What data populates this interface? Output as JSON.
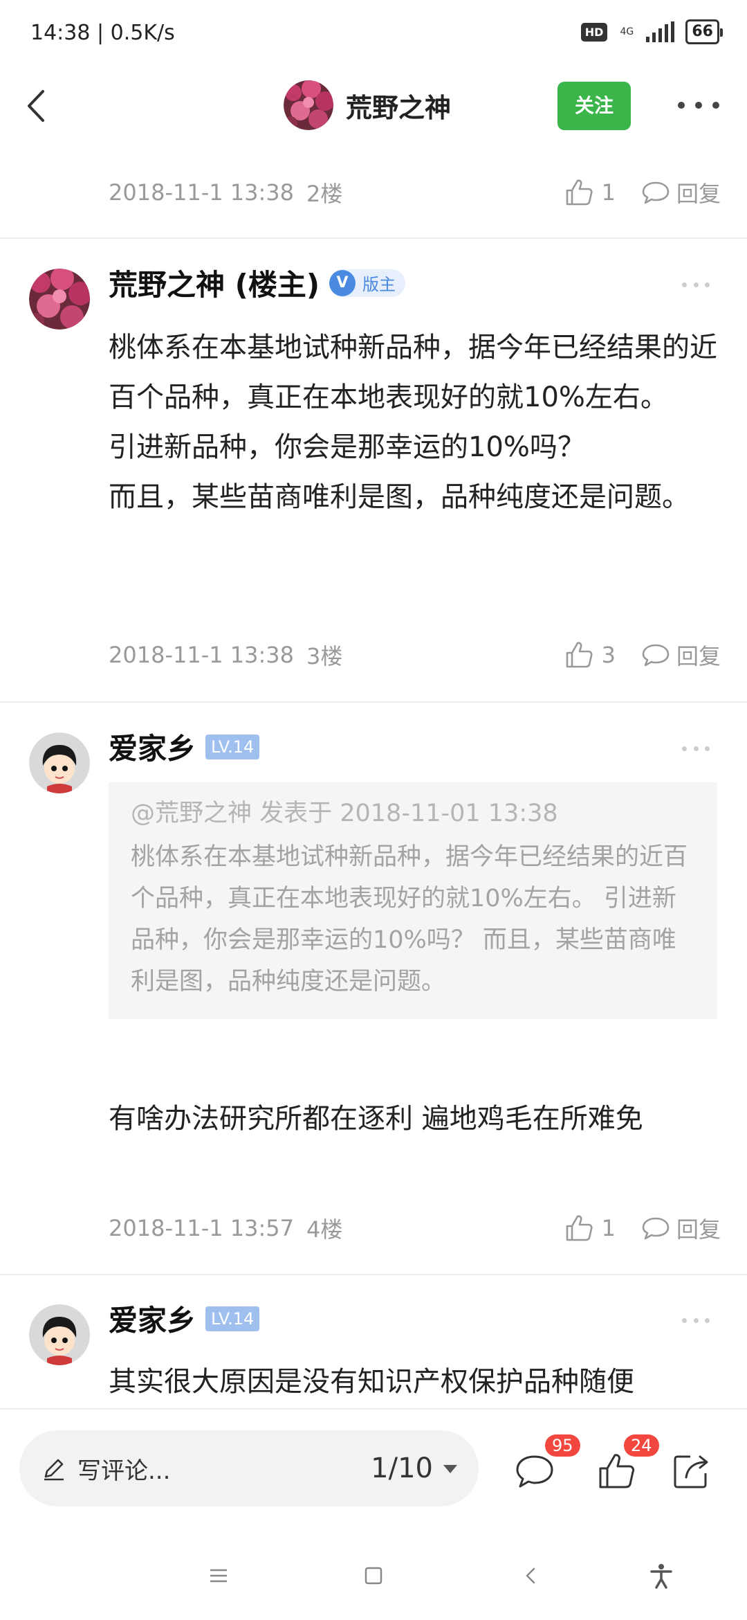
{
  "status_bar": {
    "time_speed": "14:38 | 0.5K/s",
    "hd": "HD",
    "network": "4G",
    "battery": "66"
  },
  "header": {
    "title": "荒野之神",
    "follow_label": "关注",
    "back_icon": "chevron-left-icon",
    "more_icon": "more-dots-icon"
  },
  "posts": [
    {
      "date": "2018-11-1 13:38",
      "floor": "2楼",
      "likes": "1",
      "reply_label": "回复"
    },
    {
      "author": "荒野之神 (楼主)",
      "badge_v": "V",
      "badge_role": "版主",
      "body_lines": [
        "桃体系在本基地试种新品种，据今年已经结果的近百个品种，真正在本地表现好的就10%左右。",
        "引进新品种，你会是那幸运的10%吗？",
        "而且，某些苗商唯利是图，品种纯度还是问题。"
      ],
      "date": "2018-11-1 13:38",
      "floor": "3楼",
      "likes": "3",
      "reply_label": "回复"
    },
    {
      "author": "爱家乡",
      "level": "LV.14",
      "quote_head": "@荒野之神 发表于 2018-11-01 13:38",
      "quote_text": "桃体系在本基地试种新品种，据今年已经结果的近百个品种，真正在本地表现好的就10%左右。 引进新品种，你会是那幸运的10%吗？ 而且，某些苗商唯利是图，品种纯度还是问题。",
      "body": "有啥办法研究所都在逐利 遍地鸡毛在所难免",
      "date": "2018-11-1 13:57",
      "floor": "4楼",
      "likes": "1",
      "reply_label": "回复"
    },
    {
      "author": "爱家乡",
      "level": "LV.14",
      "body": "其实很大原因是没有知识产权保护品种随便"
    }
  ],
  "bottom_bar": {
    "comment_placeholder": "写评论...",
    "page": "1/10",
    "comment_count": "95",
    "like_count": "24"
  },
  "colors": {
    "accent_green": "#3bb54a",
    "badge_red": "#f2473f",
    "verified_blue": "#4a8ae0",
    "level_blue": "#9fc0ee"
  }
}
